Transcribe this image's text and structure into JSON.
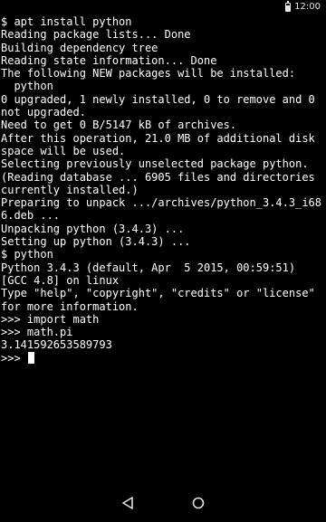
{
  "status_bar": {
    "time": "12:00",
    "battery_icon": "battery-icon"
  },
  "terminal": {
    "lines": [
      "$ apt install python",
      "Reading package lists... Done",
      "Building dependency tree",
      "Reading state information... Done",
      "The following NEW packages will be installed:",
      "  python",
      "0 upgraded, 1 newly installed, 0 to remove and 0 not upgraded.",
      "Need to get 0 B/5147 kB of archives.",
      "After this operation, 21.0 MB of additional disk space will be used.",
      "Selecting previously unselected package python.",
      "(Reading database ... 6905 files and directories currently installed.)",
      "Preparing to unpack .../archives/python_3.4.3_i686.deb ...",
      "Unpacking python (3.4.3) ...",
      "Setting up python (3.4.3) ...",
      "$ python",
      "Python 3.4.3 (default, Apr  5 2015, 00:59:51)",
      "[GCC 4.8] on linux",
      "Type \"help\", \"copyright\", \"credits\" or \"license\" for more information.",
      ">>> import math",
      ">>> math.pi",
      "3.141592653589793"
    ],
    "prompt": ">>> "
  },
  "nav_bar": {
    "back_icon": "back-triangle-icon",
    "home_icon": "home-circle-icon"
  },
  "colors": {
    "background": "#000000",
    "text": "#ffffff"
  }
}
